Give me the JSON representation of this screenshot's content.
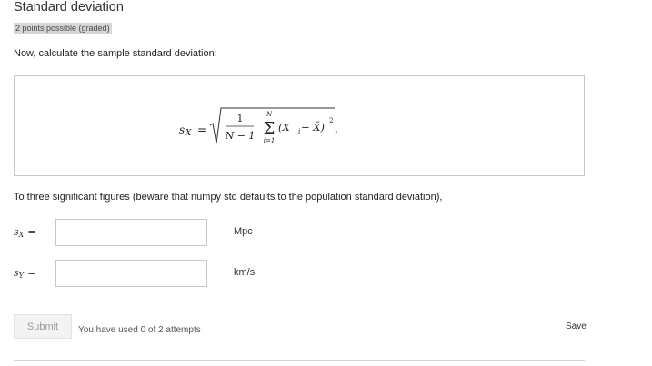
{
  "problem": {
    "title": "Standard deviation",
    "points": "2 points possible (graded)",
    "prompt": "Now, calculate the sample standard deviation:",
    "instructions": "To three significant figures (beware that numpy std defaults to the population standard deviation),"
  },
  "formula": {
    "lhs": "s",
    "lhs_sub": "X",
    "equals": "=",
    "numerator": "1",
    "denominator": "N − 1",
    "sum_upper": "N",
    "sum_lower": "i=1",
    "term_open": "(X",
    "term_open_sub": "i",
    "term_mid": " − X̄)",
    "term_exp": "2",
    "trailing": ","
  },
  "answers": [
    {
      "var": "s",
      "sub": "X",
      "equals": "=",
      "value": "",
      "unit": "Mpc"
    },
    {
      "var": "s",
      "sub": "Y",
      "equals": "=",
      "value": "",
      "unit": "km/s"
    }
  ],
  "actions": {
    "submit_label": "Submit",
    "attempts_text": "You have used 0 of 2 attempts",
    "save_label": "Save"
  }
}
